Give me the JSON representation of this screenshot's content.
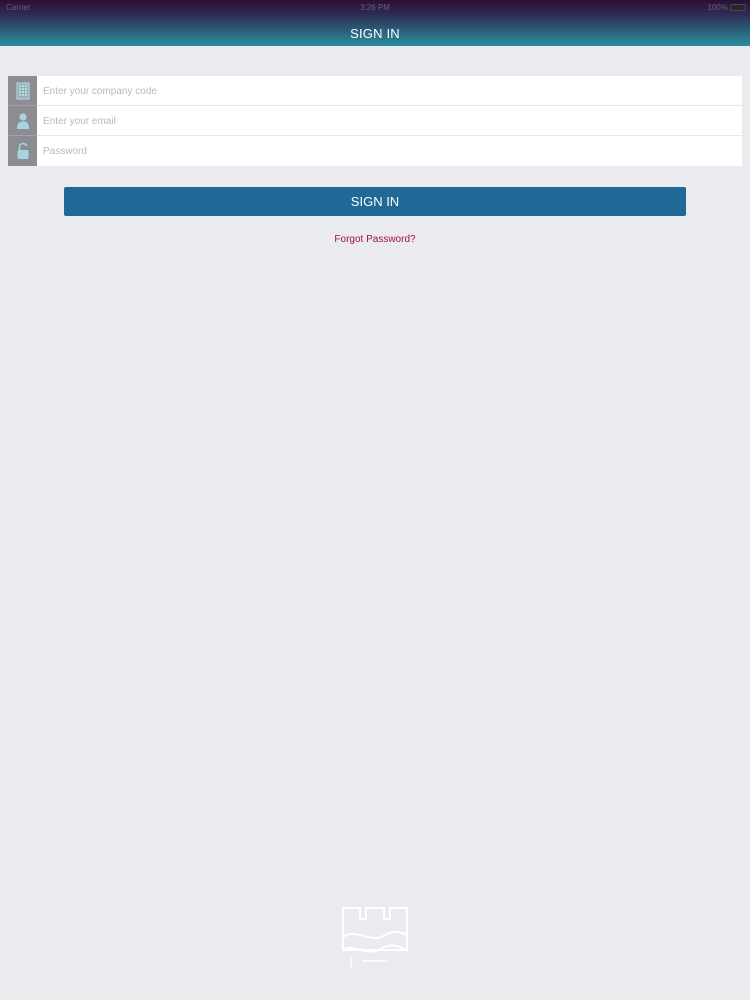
{
  "status_bar": {
    "carrier": "Carrier",
    "time": "3:26 PM",
    "battery": "100%"
  },
  "header": {
    "title": "SIGN IN"
  },
  "form": {
    "company_code": {
      "placeholder": "Enter your company code",
      "icon": "building-icon"
    },
    "email": {
      "placeholder": "Enter your email",
      "icon": "user-icon"
    },
    "password": {
      "placeholder": "Password",
      "icon": "lock-icon"
    }
  },
  "actions": {
    "signin_label": "SIGN IN",
    "forgot_label": "Forgot Password?"
  },
  "colors": {
    "background": "#ebeaef",
    "button": "#1f6996",
    "link": "#a0123e",
    "icon_bg": "#8c8d92",
    "icon_fg": "#a8d4de"
  }
}
